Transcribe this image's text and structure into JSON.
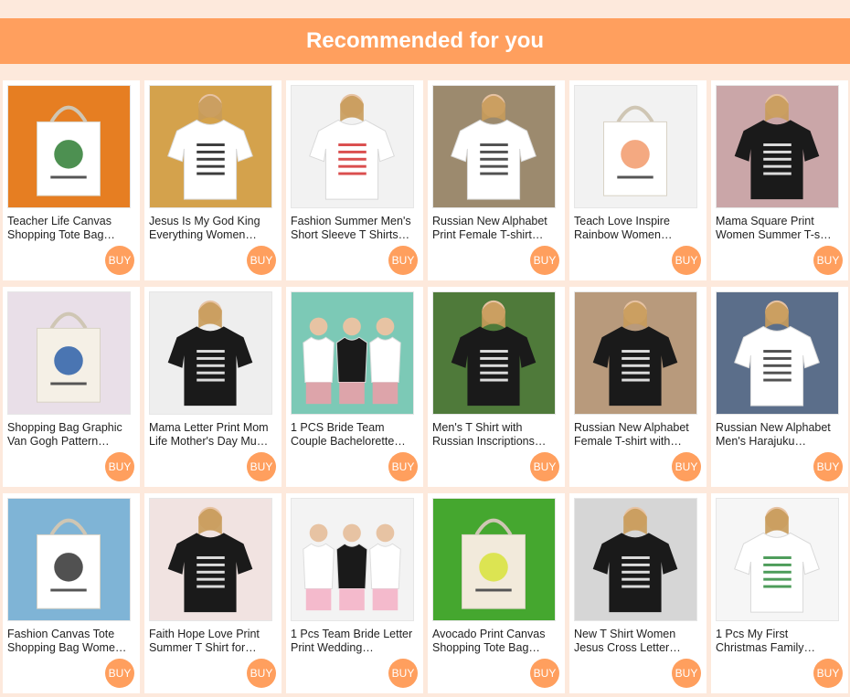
{
  "header": {
    "title": "Recommended for you"
  },
  "buy_label": "BUY",
  "colors": {
    "accent": "#ff9f5e",
    "background": "#fde9dc",
    "card": "#ffffff"
  },
  "products": [
    {
      "title": "Teacher Life Canvas Shopping Tote Bag…",
      "image_kind": "tote",
      "palette": [
        "#e67e22",
        "#ffffff",
        "#2e7d32"
      ]
    },
    {
      "title": "Jesus Is My God King Everything Women…",
      "image_kind": "tee-white",
      "palette": [
        "#d4a24c",
        "#ffffff",
        "#1a1a1a"
      ]
    },
    {
      "title": "Fashion Summer Men's Short Sleeve T Shirts…",
      "image_kind": "tee-white",
      "palette": [
        "#f2f2f2",
        "#ffffff",
        "#d32f2f"
      ]
    },
    {
      "title": "Russian New Alphabet Print Female T-shirt…",
      "image_kind": "tee-white",
      "palette": [
        "#9c8a6e",
        "#ffffff",
        "#333333"
      ]
    },
    {
      "title": "Teach Love Inspire Rainbow Women…",
      "image_kind": "tote",
      "palette": [
        "#f2f2f2",
        "#ffffff",
        "#f29a6b"
      ]
    },
    {
      "title": "Mama Square Print Women Summer T-s…",
      "image_kind": "tee-black",
      "palette": [
        "#caa6a8",
        "#1a1a1a",
        "#ffffff"
      ]
    },
    {
      "title": "Shopping Bag Graphic Van Gogh Pattern…",
      "image_kind": "tote",
      "palette": [
        "#e9dfe8",
        "#f5f0e6",
        "#2c5fa8"
      ]
    },
    {
      "title": "Mama Letter Print Mom Life Mother's Day Mu…",
      "image_kind": "tee-black",
      "palette": [
        "#eeeeee",
        "#1a1a1a",
        "#ffffff"
      ]
    },
    {
      "title": "1 PCS Bride Team Couple Bachelorette…",
      "image_kind": "group",
      "palette": [
        "#7cc9b6",
        "#ffffff",
        "#e8a0a8"
      ]
    },
    {
      "title": "Men's T Shirt with Russian Inscriptions…",
      "image_kind": "tee-black",
      "palette": [
        "#4f7a3a",
        "#1a1a1a",
        "#ffffff"
      ]
    },
    {
      "title": "Russian New Alphabet Female T-shirt with…",
      "image_kind": "tee-black",
      "palette": [
        "#b89a7c",
        "#1a1a1a",
        "#ffffff"
      ]
    },
    {
      "title": "Russian New Alphabet Men's Harajuku…",
      "image_kind": "tee-white",
      "palette": [
        "#5b6e8a",
        "#ffffff",
        "#333333"
      ]
    },
    {
      "title": "Fashion Canvas Tote Shopping Bag Wome…",
      "image_kind": "tote",
      "palette": [
        "#7fb4d6",
        "#ffffff",
        "#333333"
      ]
    },
    {
      "title": "Faith Hope Love Print Summer T Shirt for…",
      "image_kind": "tee-black",
      "palette": [
        "#f1e3e1",
        "#1a1a1a",
        "#ffffff"
      ]
    },
    {
      "title": "1 Pcs Team Bride Letter Print Wedding…",
      "image_kind": "group",
      "palette": [
        "#f3f3f3",
        "#ffffff",
        "#f4b4c8"
      ]
    },
    {
      "title": "Avocado Print Canvas Shopping Tote Bag…",
      "image_kind": "tote",
      "palette": [
        "#45a72f",
        "#f2eadb",
        "#d8e33a"
      ]
    },
    {
      "title": "New T Shirt Women Jesus Cross Letter…",
      "image_kind": "tee-black",
      "palette": [
        "#d6d6d6",
        "#1a1a1a",
        "#ffffff"
      ]
    },
    {
      "title": "1 Pcs My First Christmas Family…",
      "image_kind": "tee-white",
      "palette": [
        "#f6f6f6",
        "#ffffff",
        "#2e8b3d"
      ]
    }
  ]
}
